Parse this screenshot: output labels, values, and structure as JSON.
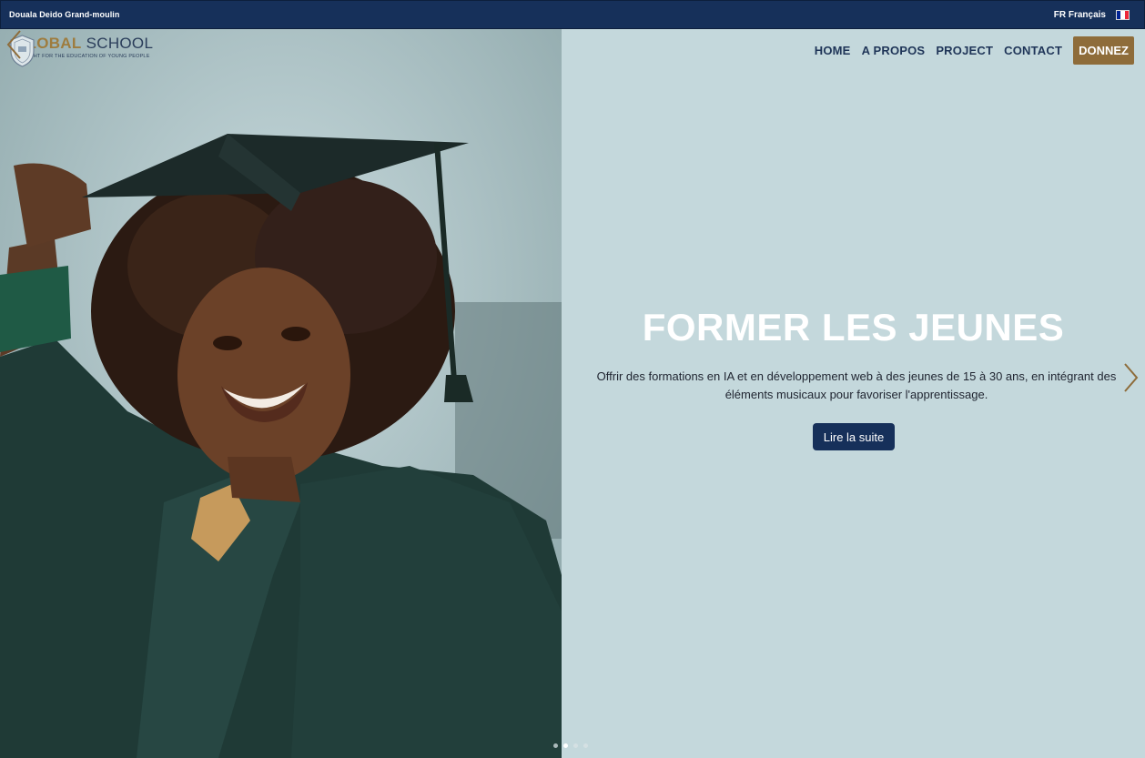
{
  "topbar": {
    "location": "Douala Deido Grand-moulin",
    "language": "FR Français",
    "flag_colors": [
      "#002395",
      "#ffffff",
      "#ed2939"
    ]
  },
  "brand": {
    "name_part1": "GLOBAL",
    "name_part2": "SCHOOL",
    "tagline": "WE FIGHT FOR THE EDUCATION OF YOUNG PEOPLE",
    "gold": "#9e7c3e",
    "navy": "#2a3d5a"
  },
  "nav": {
    "items": [
      "HOME",
      "A PROPOS",
      "PROJECT",
      "CONTACT"
    ],
    "donate": "DONNEZ"
  },
  "slide": {
    "title": "FORMER LES JEUNES",
    "description_line1": "Offrir des formations en IA et en développement web à des jeunes de 15 à 30 ans, en intégrant des",
    "description_line2": "éléments musicaux pour favoriser l'apprentissage.",
    "cta": "Lire la suite",
    "image": "graduate-woman-photo",
    "total_slides": 4,
    "active_slide": 2
  },
  "icons": {
    "prev": "chevron-left-icon",
    "next": "chevron-right-icon",
    "crest": "shield-crest-icon"
  },
  "colors": {
    "topbar": "#16305a",
    "hero_bg": "#c4d8dc",
    "donate": "#8e6c3a",
    "cta": "#16305a",
    "arrow": "#8e6c3a"
  }
}
